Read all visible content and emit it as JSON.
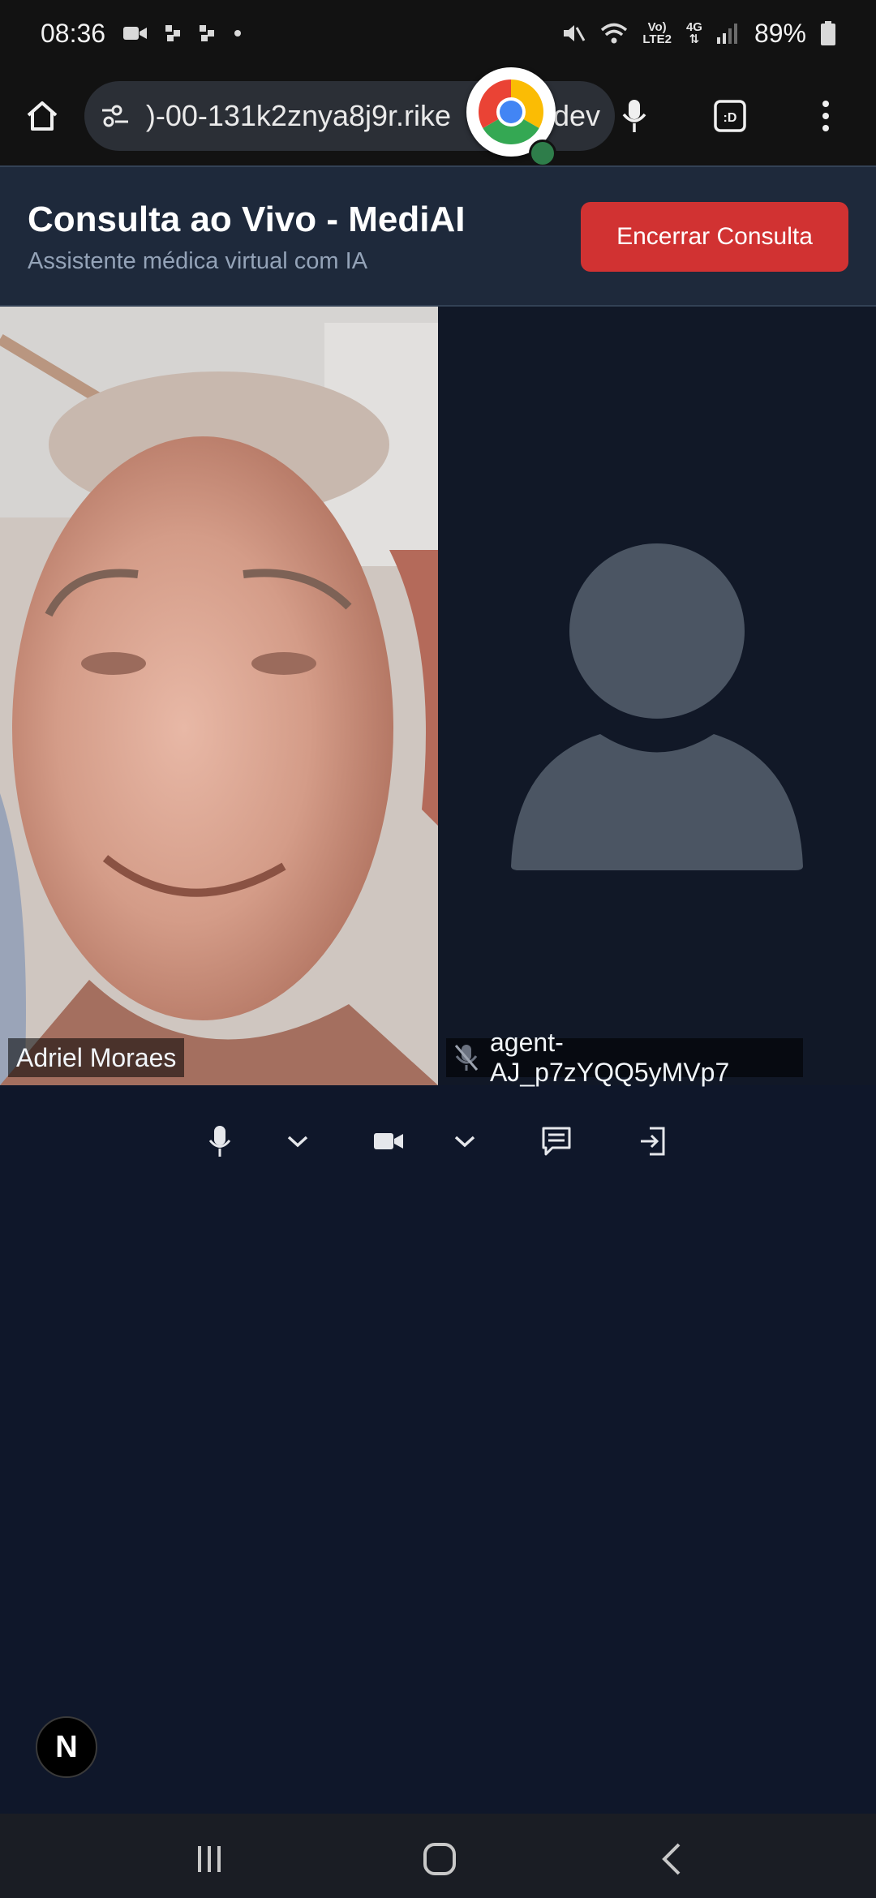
{
  "status_bar": {
    "time": "08:36",
    "network_top": "Vo)",
    "network_bottom": "LTE2",
    "network_type": "4G",
    "battery": "89%"
  },
  "browser": {
    "url": ")-00-131k2znya8j9r.rike",
    "url_end": "dev"
  },
  "app": {
    "title": "Consulta ao Vivo - MediAI",
    "subtitle": "Assistente médica virtual com IA",
    "end_button": "Encerrar Consulta"
  },
  "participants": [
    {
      "name": "Adriel Moraes"
    },
    {
      "name": "agent-AJ_p7zYQQ5yMVp7"
    }
  ],
  "badge_letter": "N",
  "colors": {
    "page_bg": "#0f172a",
    "header_bg": "#1e293b",
    "end_button": "#d13232",
    "avatar": "#4b5563"
  }
}
